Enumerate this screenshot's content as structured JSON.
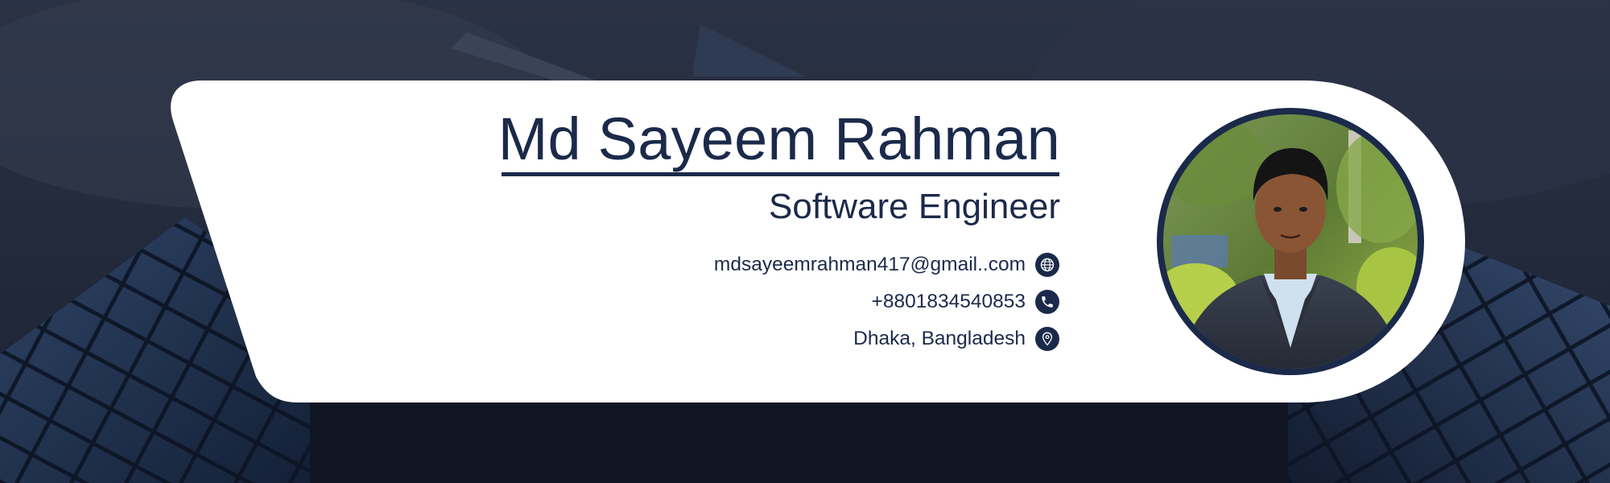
{
  "signature": {
    "name": "Md Sayeem Rahman",
    "title": "Software Engineer",
    "contacts": [
      {
        "type": "email",
        "text": "mdsayeemrahman417@gmail..com",
        "icon": "globe-icon"
      },
      {
        "type": "phone",
        "text": "+8801834540853",
        "icon": "phone-icon"
      },
      {
        "type": "location",
        "text": "Dhaka, Bangladesh",
        "icon": "location-pin-icon"
      }
    ]
  },
  "colors": {
    "navy": "#1b2a4a",
    "card": "#ffffff",
    "background_dark": "#1f2940"
  }
}
